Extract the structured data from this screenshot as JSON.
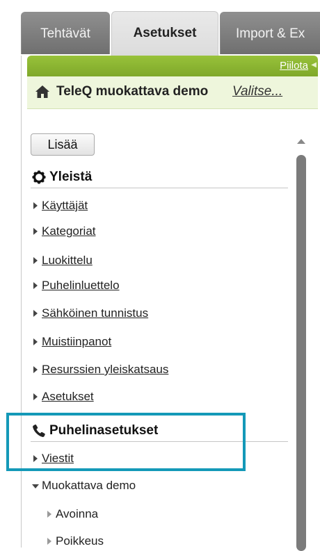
{
  "tabs": [
    {
      "label": "Tehtävät",
      "active": false
    },
    {
      "label": "Asetukset",
      "active": true
    },
    {
      "label": "Import & Ex",
      "active": false
    }
  ],
  "panel": {
    "hide_link": "Piilota",
    "title": "TeleQ muokattava demo",
    "title_link": "Valitse...",
    "add_button": "Lisää"
  },
  "sections": {
    "general": {
      "label": "Yleistä",
      "icon": "gear-icon",
      "items": [
        "Käyttäjät",
        "Kategoriat",
        "Luokittelu",
        "Puhelinluettelo",
        "Sähköinen tunnistus",
        "Muistiinpanot",
        "Resurssien yleiskatsaus",
        "Asetukset"
      ]
    },
    "phone": {
      "label": "Puhelinasetukset",
      "icon": "phone-icon",
      "items": [
        "Viestit"
      ],
      "tree": {
        "label": "Muokattava demo",
        "children": [
          "Avoinna",
          "Poikkeus"
        ]
      }
    }
  },
  "colors": {
    "accent_green": "#8fba33",
    "highlight_blue": "#1499b8",
    "tab_dark": "#7f7f7f"
  }
}
